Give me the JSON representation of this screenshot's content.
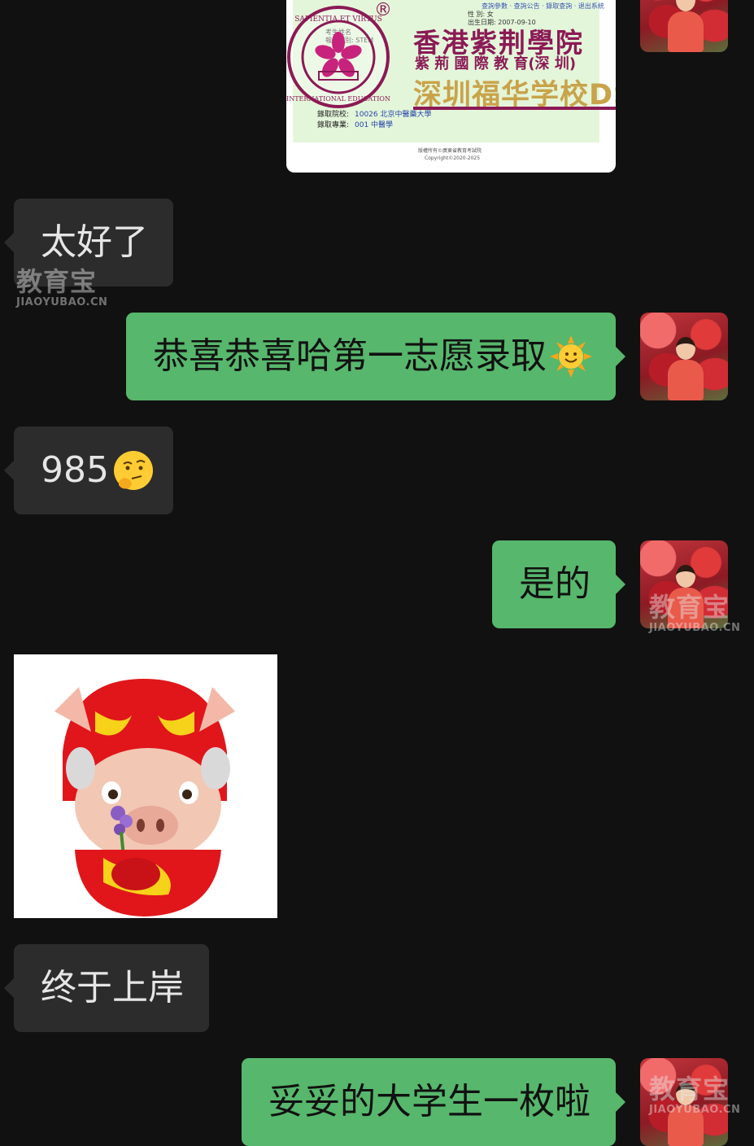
{
  "shared_image": {
    "title_big": "香港紫荆學院",
    "title_sub": "紫 荊 國 際 教 育(深 圳)",
    "title_school": "深圳福华学校DSE",
    "seal_ring_text": "SAPIENTIA ET VIRTUS · BAUHINIA · INTERNATIONAL · EDUCATION",
    "registered_mark": "®",
    "row_school_label": "錄取院校:",
    "row_school_value": "10026 北京中醫藥大學",
    "row_major_label": "錄取專業:",
    "row_major_value": "001 中醫學",
    "footer_line1": "版權所有©廣東省教育考試院",
    "footer_line2": "Copyright©2020-2025"
  },
  "messages": [
    {
      "side": "left",
      "text": "太好了"
    },
    {
      "side": "right",
      "text": "恭喜恭喜哈第一志愿录取",
      "emoji": "sun-face-emoji"
    },
    {
      "side": "left",
      "text": "985",
      "emoji": "thinking-face-emoji"
    },
    {
      "side": "right",
      "text": "是的"
    },
    {
      "side": "left",
      "sticker": "pig-character-sticker"
    },
    {
      "side": "left",
      "text": "终于上岸"
    },
    {
      "side": "right",
      "text": "妥妥的大学生一枚啦"
    }
  ],
  "watermark": {
    "cn": "教育宝",
    "en": "JIAOYUBAO.CN"
  },
  "colors": {
    "background": "#111111",
    "left_bubble": "#2c2c2c",
    "right_bubble": "#57b76c",
    "seal": "#8b1a55",
    "school_gold": "#c9a34a"
  }
}
